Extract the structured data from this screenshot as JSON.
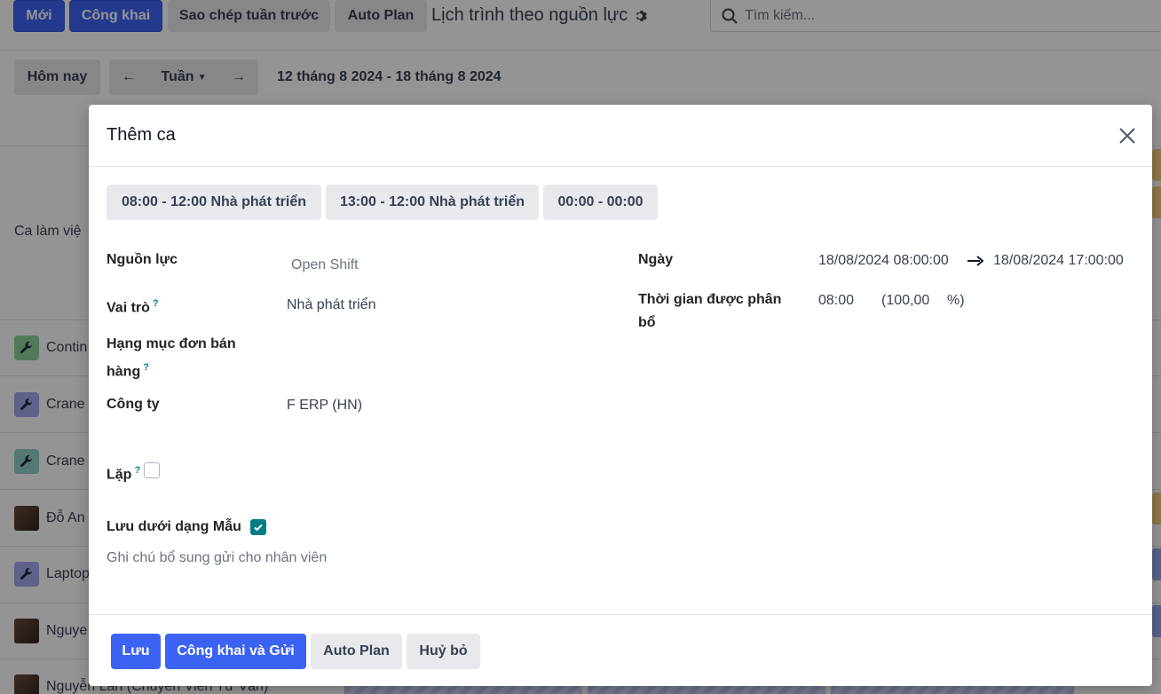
{
  "control_panel": {
    "new_label": "Mới",
    "publish_label": "Công khai",
    "copy_week_label": "Sao chép tuần trước",
    "auto_plan_label": "Auto Plan",
    "view_title": "Lịch trình theo nguồn lực",
    "search_placeholder": "Tìm kiếm..."
  },
  "toolbar": {
    "today_label": "Hôm nay",
    "period_label": "Tuần",
    "date_range": "12 tháng 8 2024 - 18 tháng 8 2024"
  },
  "background_rows": {
    "open_shifts_label": "Ca làm việ",
    "rows": [
      {
        "label": "Contin",
        "icon": "wrench-icon",
        "color": "#8fd19e"
      },
      {
        "label": "Crane",
        "icon": "wrench-icon",
        "color": "#a5a8f0"
      },
      {
        "label": "Crane",
        "icon": "wrench-icon",
        "color": "#8fd1c4"
      },
      {
        "label": "Đỗ An",
        "icon": "avatar"
      },
      {
        "label": "Laptop",
        "icon": "wrench-icon",
        "color": "#a5a8f0"
      },
      {
        "label": "Nguye",
        "icon": "avatar"
      },
      {
        "label": "Nguyễn Lan (Chuyên Viên Tư Vấn)",
        "icon": "avatar"
      }
    ]
  },
  "modal": {
    "title": "Thêm ca",
    "templates": [
      "08:00 - 12:00 Nhà phát triển",
      "13:00 - 12:00 Nhà phát triển",
      "00:00 - 00:00"
    ],
    "fields": {
      "resource_label": "Nguồn lực",
      "resource_value": "Open Shift",
      "role_label": "Vai trò",
      "role_value": "Nhà phát triển",
      "sale_line_label_1": "Hạng mục đơn bán",
      "sale_line_label_2": "hàng",
      "company_label": "Công ty",
      "company_value": "F ERP (HN)",
      "repeat_label": "Lặp",
      "repeat_checked": false,
      "save_template_label": "Lưu dưới dạng Mẫu",
      "save_template_checked": true,
      "note_placeholder": "Ghi chú bổ sung gửi cho nhân viên",
      "date_label": "Ngày",
      "date_start": "18/08/2024 08:00:00",
      "date_end": "18/08/2024 17:00:00",
      "allocated_label_1": "Thời gian được phân",
      "allocated_label_2": "bổ",
      "allocated_hours": "08:00",
      "allocated_percent": "(100,00",
      "percent_sign": "%)",
      "help_mark": "?"
    },
    "footer": {
      "save_label": "Lưu",
      "publish_send_label": "Công khai và Gửi",
      "auto_plan_label": "Auto Plan",
      "cancel_label": "Huỷ bỏ"
    }
  },
  "colors": {
    "primary": "#3b63f3",
    "secondary": "#e7e9ed",
    "checkbox_checked": "#017e84",
    "help": "#0180a5"
  }
}
